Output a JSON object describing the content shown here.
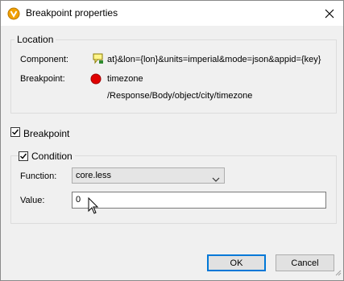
{
  "window": {
    "title": "Breakpoint properties"
  },
  "location": {
    "legend": "Location",
    "component_label": "Component:",
    "component_value": "at}&lon={lon}&units=imperial&mode=json&appid={key}",
    "breakpoint_label": "Breakpoint:",
    "breakpoint_name": "timezone",
    "breakpoint_path": "/Response/Body/object/city/timezone"
  },
  "breakpoint_checkbox": {
    "label": "Breakpoint",
    "checked": true
  },
  "condition": {
    "legend": "Condition",
    "checked": true,
    "function_label": "Function:",
    "function_value": "core.less",
    "value_label": "Value:",
    "value_text": "0"
  },
  "buttons": {
    "ok": "OK",
    "cancel": "Cancel"
  },
  "colors": {
    "breakpoint_dot": "#e00000",
    "accent": "#0078d7",
    "app_icon": "#f2a100"
  },
  "icons": [
    "app-icon",
    "close-icon",
    "component-icon",
    "breakpoint-dot-icon",
    "chevron-down-icon",
    "mouse-cursor-icon"
  ]
}
